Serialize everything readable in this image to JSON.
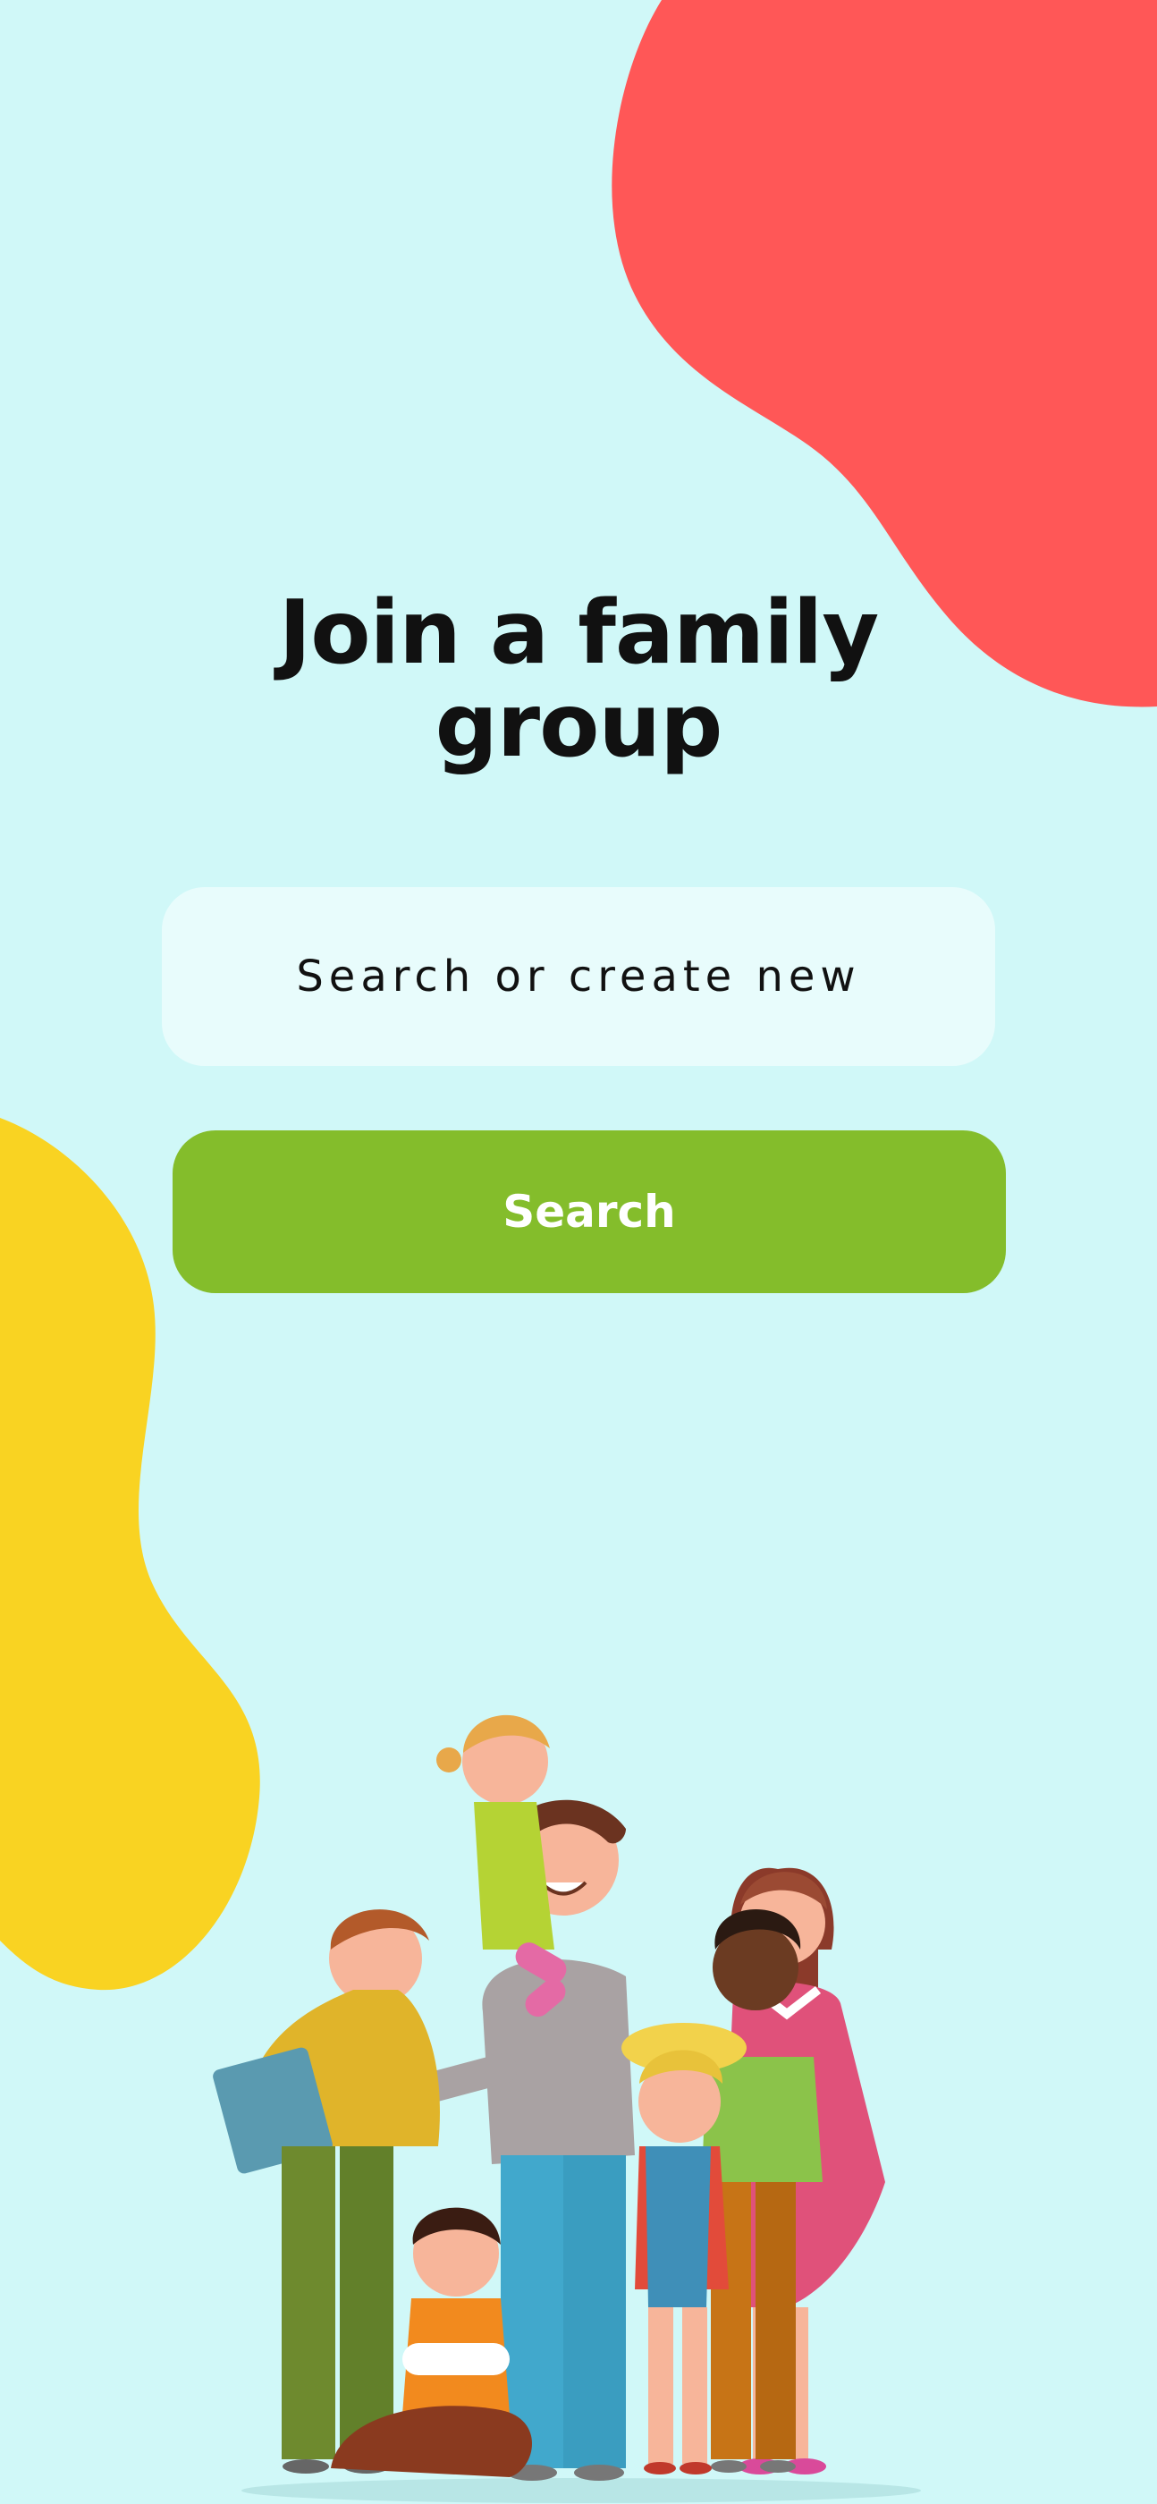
{
  "page": {
    "title_line1": "Join a family",
    "title_line2": "group"
  },
  "search": {
    "placeholder": "Search or create new",
    "value": ""
  },
  "actions": {
    "search_label": "Search"
  },
  "illustration": {
    "icon": "family-group-illustration"
  },
  "colors": {
    "background": "#d0f8f8",
    "accent_red": "#ff5757",
    "accent_yellow": "#f9d322",
    "button_green": "#84bd2b",
    "field_bg": "#e8fcfc"
  }
}
